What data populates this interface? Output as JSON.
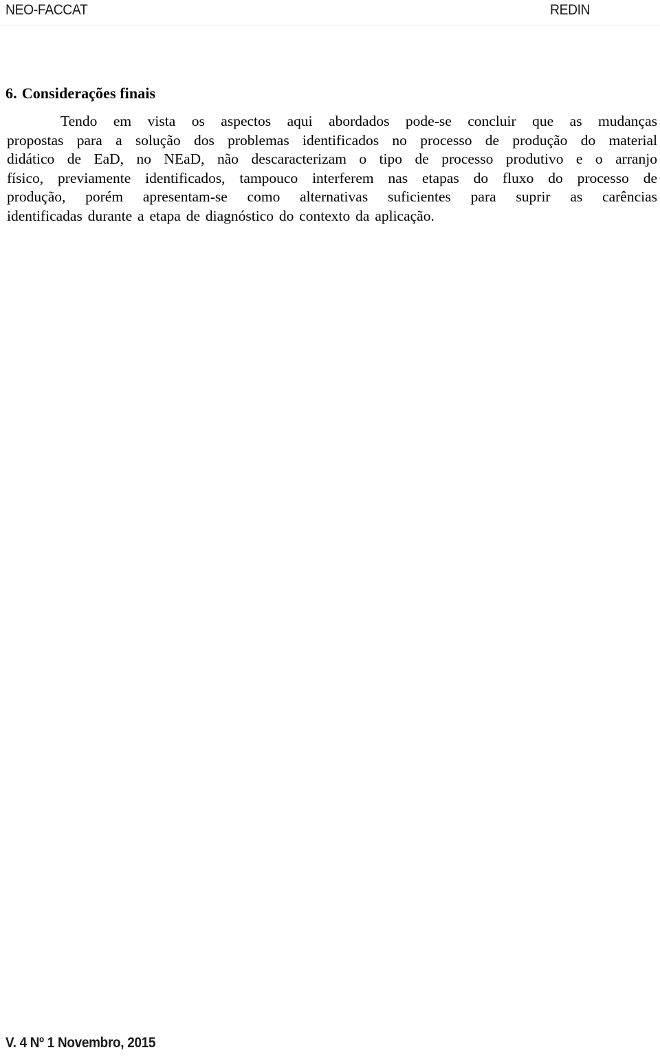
{
  "header": {
    "left_label": "NEO-FACCAT",
    "right_label": "REDIN"
  },
  "section": {
    "number": "6.",
    "title": "Considerações finais"
  },
  "body": {
    "full_text": "Tendo em vista os aspectos aqui abordados pode-se concluir que as mudanças propostas para a solução dos problemas identificados no processo de produção do material didático de EaD, no NEaD, não descaracterizam o tipo de processo produtivo e o arranjo físico, previamente identificados, tampouco interferem nas etapas do fluxo do processo de produção, porém apresentam-se como alternativas suficientes para suprir as carências identificadas durante a etapa de diagnóstico do contexto da aplicação.",
    "lines": [
      "Tendo em vista os aspectos aqui abordados pode-se concluir que as mudanças",
      "propostas para a solução dos problemas identificados no processo de produção do material",
      "didático de EaD, no NEaD, não descaracterizam o tipo de processo produtivo e o arranjo",
      "físico, previamente identificados, tampouco interferem nas etapas do fluxo do processo de",
      "produção, porém apresentam-se como alternativas suficientes para suprir as carências",
      "identificadas durante a etapa de diagnóstico do contexto da aplicação."
    ]
  },
  "footer": {
    "citation": "V. 4 Nº 1 Novembro, 2015"
  },
  "colors": {
    "text": "#000000",
    "header_text": "#1a1a1a",
    "page_background": "#ffffff",
    "rule": "#f2f2f4"
  }
}
